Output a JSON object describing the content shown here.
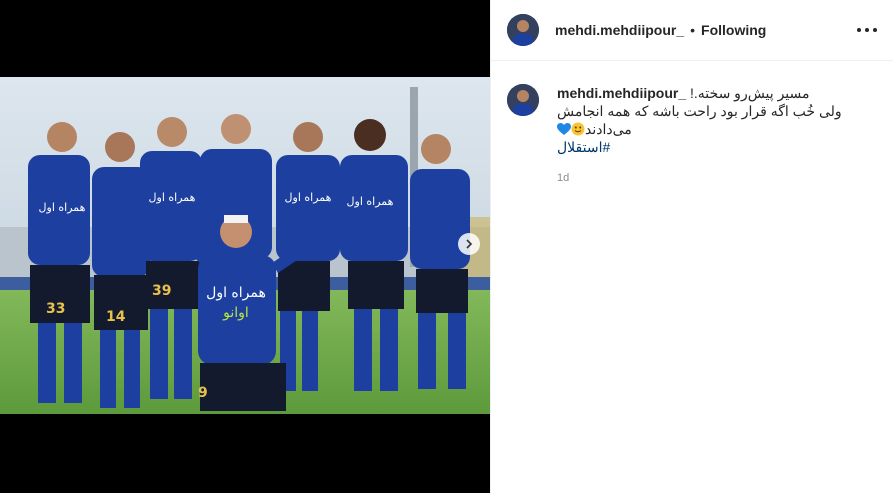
{
  "post": {
    "username": "mehdi.mehdiipour_",
    "follow_status": "Following",
    "dot": "•"
  },
  "caption": {
    "username": "mehdi.mehdiipour_",
    "line1": "مسیر پیش‌رو سخته.!",
    "line2": "ولی خُب اگه قرار بود راحت باشه که همه انجامش",
    "line3": "می‌دادند",
    "hashtag": "#استقلال",
    "time": "1d"
  },
  "photo": {
    "jersey_numbers": [
      "33",
      "14",
      "39",
      "9"
    ],
    "sponsor_text": "همراه اول",
    "brand_text": "اوانو"
  },
  "colors": {
    "kit_blue": "#1d3fa0",
    "pitch_green": "#6da84a",
    "link_blue": "#00376b",
    "heart_blue": "#1e88e5"
  },
  "icons": {
    "more": "more-horizontal-icon",
    "next": "chevron-right-icon",
    "heart": "blue-heart-emoji",
    "smiley": "smiley-emoji"
  }
}
